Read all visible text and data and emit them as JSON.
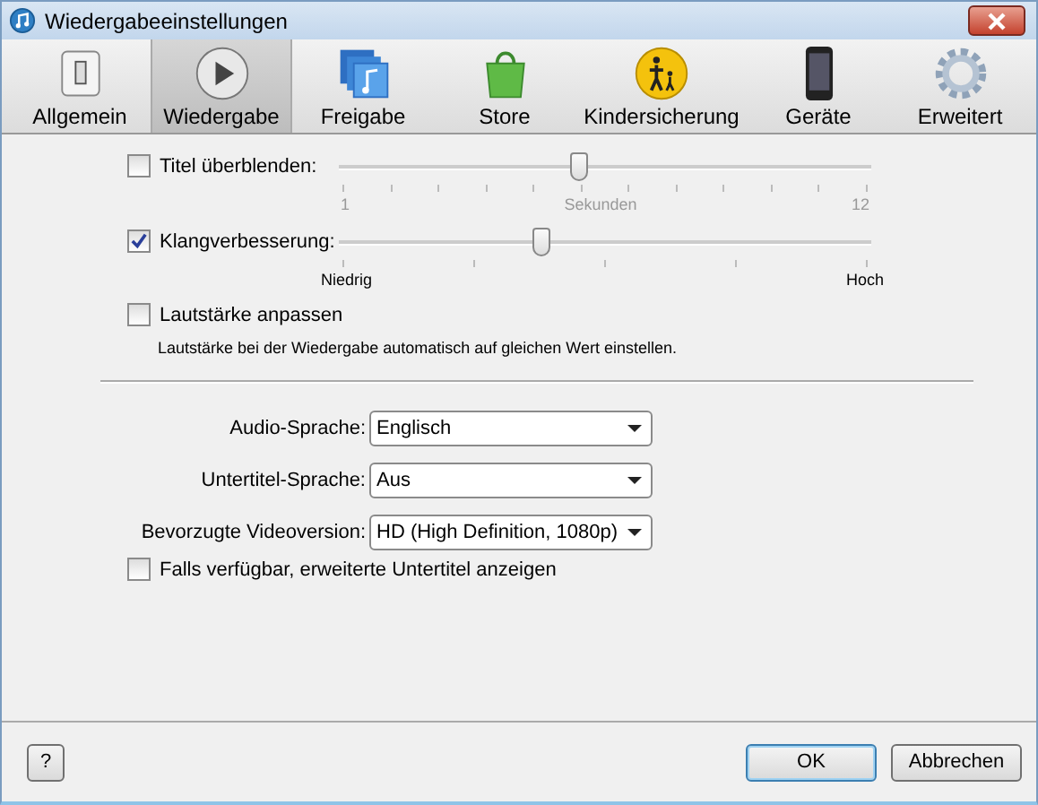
{
  "window": {
    "title": "Wiedergabeeinstellungen"
  },
  "toolbar": [
    {
      "label": "Allgemein",
      "selected": false
    },
    {
      "label": "Wiedergabe",
      "selected": true
    },
    {
      "label": "Freigabe",
      "selected": false
    },
    {
      "label": "Store",
      "selected": false
    },
    {
      "label": "Kindersicherung",
      "selected": false
    },
    {
      "label": "Geräte",
      "selected": false
    },
    {
      "label": "Erweitert",
      "selected": false
    }
  ],
  "sliders": [
    {
      "label": "Titel überblenden:",
      "checked": false,
      "level": 0.45,
      "scale": [
        "1",
        "Sekunden",
        "12"
      ]
    },
    {
      "label": "Klangverbesserung:",
      "checked": true,
      "level": 0.38,
      "scale": [
        "Niedrig",
        "Hoch"
      ]
    }
  ],
  "volume": {
    "label": "Lautstärke anpassen",
    "checked": false,
    "hint": "Lautstärke bei der Wiedergabe automatisch auf gleichen Wert einstellen."
  },
  "dropdowns": [
    {
      "label": "Audio-Sprache:",
      "value": "Englisch"
    },
    {
      "label": "Untertitel-Sprache:",
      "value": "Aus"
    },
    {
      "label": "Bevorzugte Videoversion:",
      "value": "HD (High Definition, 1080p)"
    }
  ],
  "subtitles": {
    "label": "Falls verfügbar, erweiterte Untertitel anzeigen",
    "checked": false
  },
  "buttons": {
    "help": "?",
    "ok": "OK",
    "cancel": "Abbrechen"
  }
}
